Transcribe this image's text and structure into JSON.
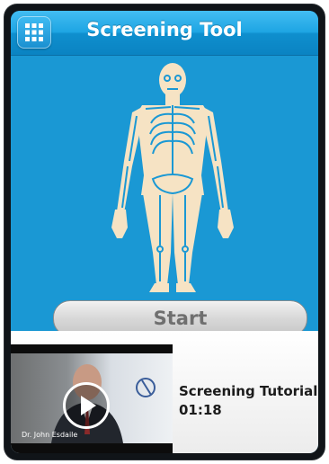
{
  "header": {
    "title": "Screening Tool",
    "menu_icon": "grid-menu-icon"
  },
  "main": {
    "figure_icon": "human-skeleton-icon",
    "start_label": "Start"
  },
  "tutorial": {
    "title": "Screening Tutorial",
    "duration": "01:18",
    "thumbnail_caption": "Dr. John Esdaile",
    "play_icon": "play-icon"
  },
  "colors": {
    "header_blue": "#1ea5e3",
    "body_blue": "#1a98d4",
    "figure_fill": "#f6e3c4",
    "button_gray": "#d8d8d8"
  }
}
